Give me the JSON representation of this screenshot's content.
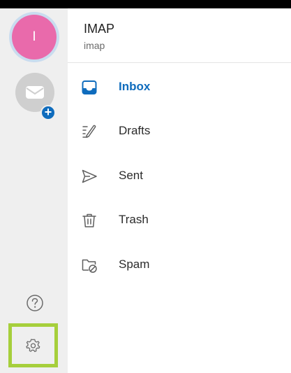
{
  "account": {
    "initial": "I",
    "title": "IMAP",
    "subtitle": "imap"
  },
  "folders": [
    {
      "label": "Inbox",
      "icon": "inbox-icon",
      "active": true
    },
    {
      "label": "Drafts",
      "icon": "drafts-icon"
    },
    {
      "label": "Sent",
      "icon": "sent-icon"
    },
    {
      "label": "Trash",
      "icon": "trash-icon"
    },
    {
      "label": "Spam",
      "icon": "spam-icon"
    }
  ],
  "rail": {
    "add_badge": "+",
    "icons": [
      "mail-icon",
      "help-icon",
      "settings-icon"
    ]
  },
  "colors": {
    "accent": "#0f6cbd",
    "avatar": "#e96aab",
    "highlight": "#a6cf3c"
  }
}
